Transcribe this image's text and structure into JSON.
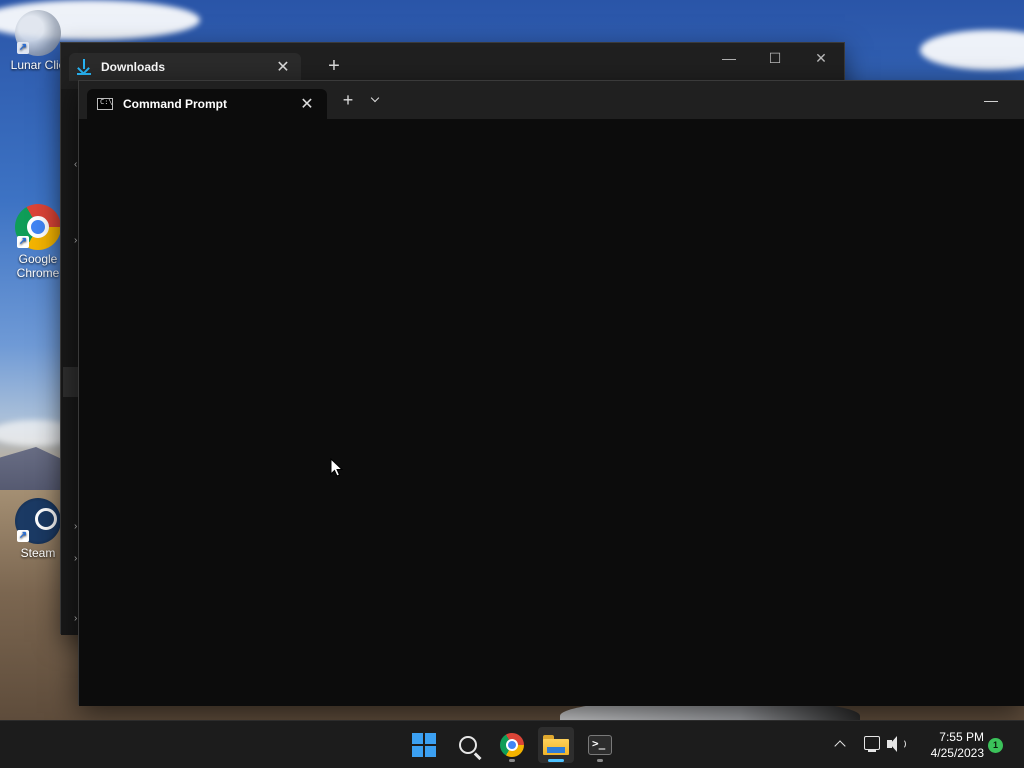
{
  "desktop": {
    "icons": [
      {
        "label": "Lunar Clie",
        "icon": "lunar-client-icon"
      },
      {
        "label": "Google\nChrome",
        "icon": "chrome-icon"
      },
      {
        "label": "Steam",
        "icon": "steam-icon"
      }
    ]
  },
  "explorer_window": {
    "tab_title": "Downloads",
    "tab_icon": "download-icon",
    "new_tab": "+",
    "close_glyph": "✕",
    "minimize_glyph": "—",
    "maximize_glyph": "☐"
  },
  "terminal_window": {
    "tab_title": "Command Prompt",
    "tab_icon": "command-prompt-icon",
    "tab_icon_text": "C:\\",
    "new_tab": "+",
    "close_glyph": "✕",
    "minimize_glyph": "—",
    "background": "#0c0c0c"
  },
  "taskbar": {
    "apps": [
      {
        "name": "Start",
        "icon": "windows-logo-icon"
      },
      {
        "name": "Search",
        "icon": "search-icon"
      },
      {
        "name": "Google Chrome",
        "icon": "chrome-icon"
      },
      {
        "name": "File Explorer",
        "icon": "folder-icon"
      },
      {
        "name": "Terminal",
        "icon": "terminal-icon",
        "icon_text": ">_"
      }
    ],
    "clock": {
      "time": "7:55 PM",
      "date": "4/25/2023"
    },
    "notification_count": "1",
    "accent_color": "#4cc2ff"
  }
}
